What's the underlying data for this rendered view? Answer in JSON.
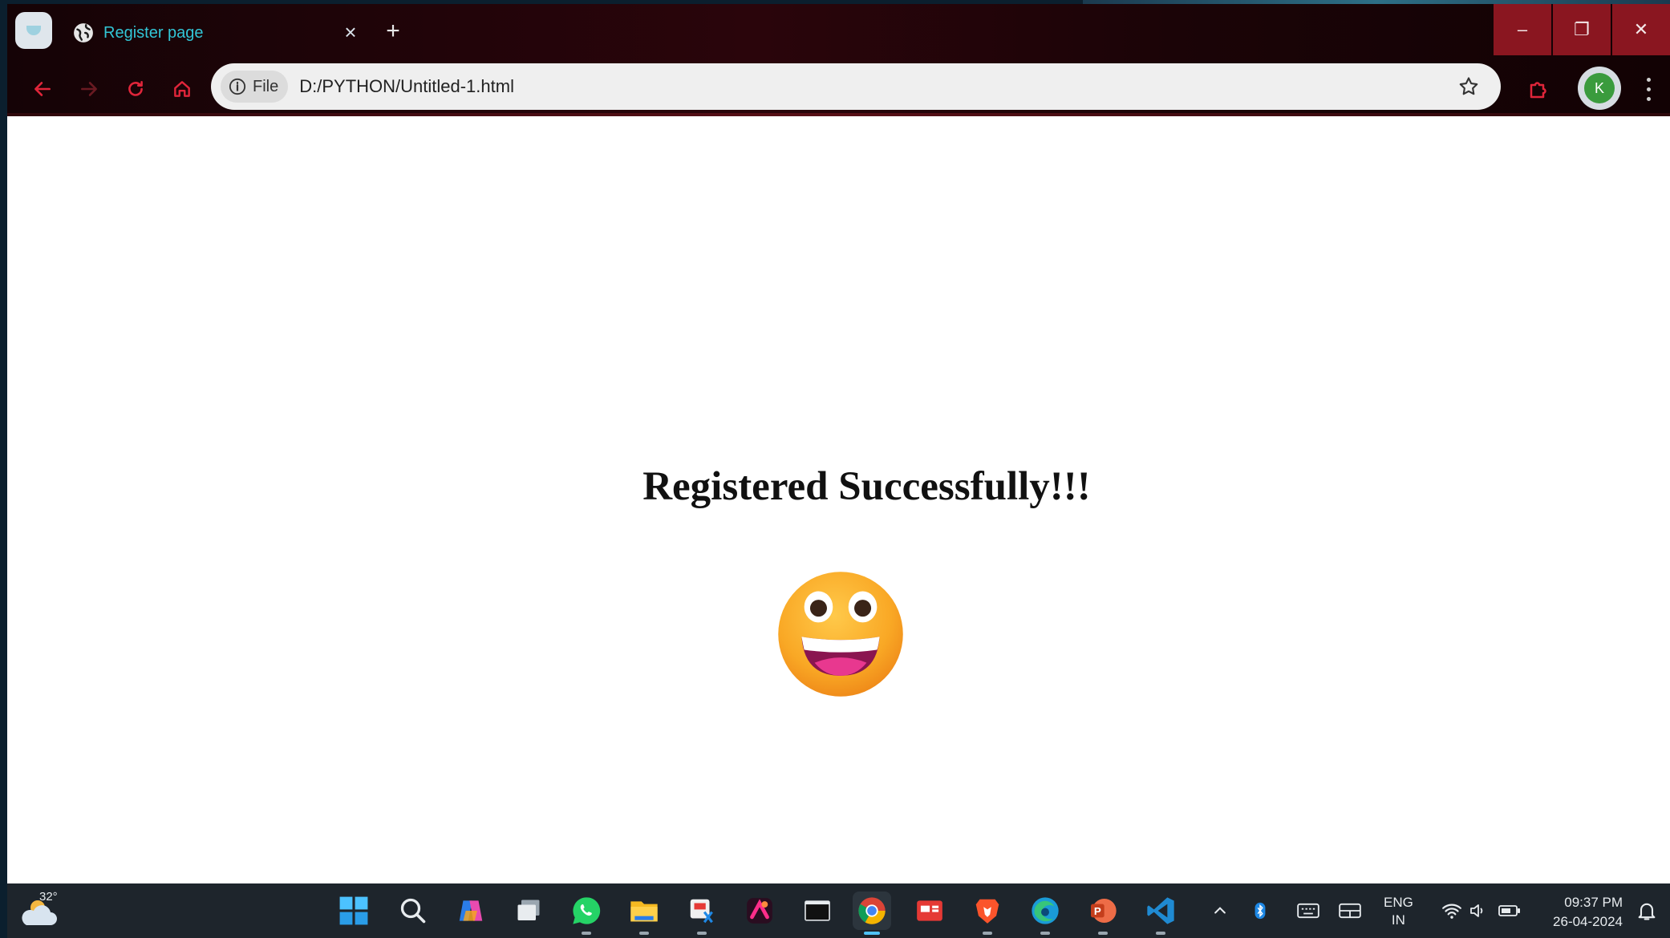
{
  "browser": {
    "tab_title": "Register page",
    "tab_close_glyph": "×",
    "new_tab_glyph": "+",
    "site_chip_label": "File",
    "url": "D:/PYTHON/Untitled-1.html",
    "profile_initial": "K",
    "window_controls": {
      "minimize": "–",
      "restore": "❐",
      "close": "✕"
    },
    "icons": [
      "back-arrow-icon",
      "forward-arrow-icon",
      "reload-icon",
      "home-icon",
      "info-icon",
      "bookmark-star-icon",
      "extensions-puzzle-icon",
      "kebab-menu-icon"
    ],
    "colors": {
      "tab_title": "#32c6d6",
      "nav_icons": "#e0253a",
      "window_controls_bg": "#8a1620"
    }
  },
  "page": {
    "heading": "Registered Successfully!!!",
    "emoji": "grinning-face-emoji"
  },
  "taskbar": {
    "weather_temp": "32°",
    "lang_top": "ENG",
    "lang_bottom": "IN",
    "time": "09:37 PM",
    "date": "26-04-2024",
    "apps": [
      "start",
      "search",
      "copilot",
      "task-view",
      "whatsapp",
      "file-explorer",
      "snipping-tool",
      "app-pink",
      "terminal",
      "chrome",
      "news",
      "brave",
      "edge",
      "powerpoint",
      "vscode"
    ],
    "tray": [
      "chevron-up",
      "bluetooth",
      "keyboard",
      "display",
      "wifi",
      "volume",
      "battery",
      "notification-bell"
    ]
  }
}
